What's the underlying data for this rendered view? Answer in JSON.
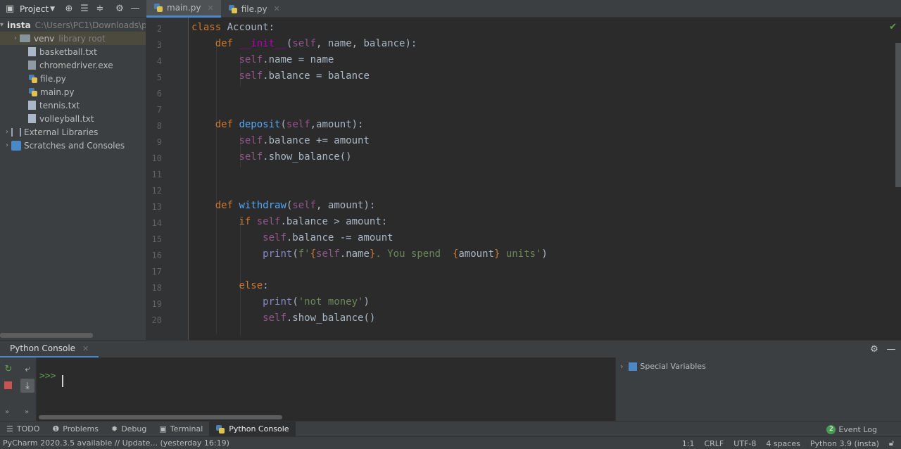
{
  "toolbar": {
    "project_label": "Project",
    "icons": [
      "target-icon",
      "expand-all-icon",
      "collapse-all-icon",
      "gear-icon",
      "minimize-icon"
    ]
  },
  "tabs": [
    {
      "label": "main.py",
      "active": true
    },
    {
      "label": "file.py",
      "active": false
    }
  ],
  "project_tree": {
    "root": {
      "name": "insta",
      "path": "C:\\Users\\PC1\\Downloads\\p"
    },
    "items": [
      {
        "name": "venv",
        "note": "library root"
      },
      {
        "name": "basketball.txt"
      },
      {
        "name": "chromedriver.exe"
      },
      {
        "name": "file.py"
      },
      {
        "name": "main.py"
      },
      {
        "name": "tennis.txt"
      },
      {
        "name": "volleyball.txt"
      },
      {
        "name": "External Libraries"
      },
      {
        "name": "Scratches and Consoles"
      }
    ]
  },
  "editor": {
    "line_numbers": [
      "2",
      "3",
      "4",
      "5",
      "6",
      "7",
      "8",
      "9",
      "10",
      "11",
      "12",
      "13",
      "14",
      "15",
      "16",
      "17",
      "18",
      "19",
      "20"
    ]
  },
  "console": {
    "tab_label": "Python Console",
    "prompt": ">>>",
    "variables_label": "Special Variables"
  },
  "bottom_tabs": [
    "TODO",
    "Problems",
    "Debug",
    "Terminal",
    "Python Console"
  ],
  "event_log": {
    "count": "2",
    "label": "Event Log"
  },
  "status": {
    "message": "PyCharm 2020.3.5 available // Update... (yesterday 16:19)",
    "position": "1:1",
    "line_sep": "CRLF",
    "encoding": "UTF-8",
    "indent": "4 spaces",
    "interpreter": "Python 3.9 (insta)"
  },
  "colors": {
    "accent": "#4a88c7",
    "keyword": "#cc7832",
    "self": "#94558d",
    "function": "#56a8f5",
    "string": "#6a8759"
  }
}
